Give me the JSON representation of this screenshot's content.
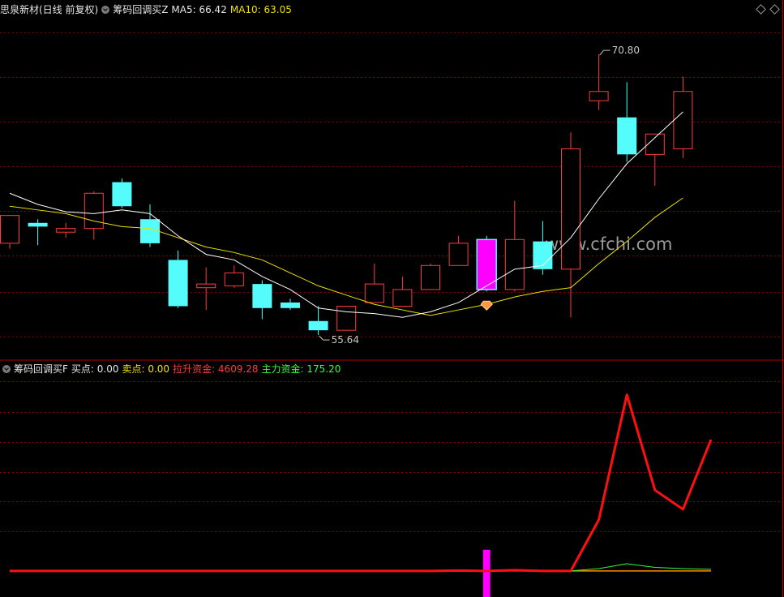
{
  "header_main": {
    "stock": "思泉新材(日线 前复权)",
    "indicator": "筹码回调买Z",
    "ma5_label": "MA5: 66.42",
    "ma10_label": "MA10: 63.05"
  },
  "header_sub": {
    "indicator": "筹码回调买F",
    "buy_label": "买点: 0.00",
    "sell_label": "卖点: 0.00",
    "lift_label": "拉升资金: 4609.28",
    "main_label": "主力资金: 175.20"
  },
  "watermark": "www.cfchi.com",
  "colors": {
    "up": "#ff3b3b",
    "down": "#54fcfc",
    "signal": "#ff00ff",
    "ma5": "#ffffff",
    "ma10": "#f0e000",
    "lift": "#ff1010",
    "main": "#33ff33",
    "grid": "#8b0000",
    "baseline": "#ff8800"
  },
  "chart_data": [
    {
      "type": "candlestick",
      "ylim": [
        54.9,
        72.6
      ],
      "high_annotation": "70.80",
      "low_annotation": "55.64",
      "candles": [
        {
          "o": 60.6,
          "h": 61.3,
          "c": 62.1,
          "l": 60.3
        },
        {
          "o": 61.7,
          "h": 61.9,
          "c": 61.5,
          "l": 60.5
        },
        {
          "o": 61.2,
          "h": 61.7,
          "c": 61.4,
          "l": 60.9
        },
        {
          "o": 61.4,
          "h": 63.4,
          "c": 63.3,
          "l": 60.8
        },
        {
          "o": 63.9,
          "h": 64.1,
          "c": 62.6,
          "l": 62.5
        },
        {
          "o": 61.9,
          "h": 62.7,
          "c": 60.6,
          "l": 60.4
        },
        {
          "o": 59.7,
          "h": 60.2,
          "c": 57.2,
          "l": 57.1
        },
        {
          "o": 58.2,
          "h": 59.3,
          "c": 58.4,
          "l": 57.0
        },
        {
          "o": 58.3,
          "h": 59.4,
          "c": 59.0,
          "l": 58.2
        },
        {
          "o": 58.4,
          "h": 58.6,
          "c": 57.1,
          "l": 56.5
        },
        {
          "o": 57.4,
          "h": 57.6,
          "c": 57.1,
          "l": 57.0
        },
        {
          "o": 56.4,
          "h": 57.2,
          "c": 55.9,
          "l": 55.64
        },
        {
          "o": 55.9,
          "h": 57.2,
          "c": 57.2,
          "l": 55.9
        },
        {
          "o": 57.4,
          "h": 59.5,
          "c": 58.4,
          "l": 57.4
        },
        {
          "o": 57.2,
          "h": 58.8,
          "c": 58.1,
          "l": 57.2
        },
        {
          "o": 58.1,
          "h": 59.5,
          "c": 59.4,
          "l": 58.1
        },
        {
          "o": 59.4,
          "h": 61.0,
          "c": 60.6,
          "l": 59.4
        },
        {
          "o": 60.8,
          "h": 61.0,
          "c": 58.1,
          "l": 58.0
        },
        {
          "o": 58.1,
          "h": 62.9,
          "c": 60.8,
          "l": 58.0
        },
        {
          "o": 60.7,
          "h": 61.8,
          "c": 59.2,
          "l": 58.9
        },
        {
          "o": 59.2,
          "h": 66.6,
          "c": 65.7,
          "l": 56.6
        },
        {
          "o": 68.3,
          "h": 70.8,
          "c": 68.8,
          "l": 67.8
        },
        {
          "o": 67.4,
          "h": 69.3,
          "c": 65.4,
          "l": 65.0
        },
        {
          "o": 65.4,
          "h": 65.9,
          "c": 66.5,
          "l": 63.7
        },
        {
          "o": 65.7,
          "h": 69.6,
          "c": 68.8,
          "l": 65.2
        }
      ],
      "ma5": [
        63.3,
        62.7,
        62.3,
        62.2,
        62.4,
        62.2,
        61.0,
        60.0,
        59.7,
        58.8,
        58.1,
        57.1,
        56.9,
        56.8,
        56.6,
        56.9,
        57.4,
        58.3,
        59.2,
        59.4,
        60.9,
        63.0,
        64.9,
        66.3,
        67.7
      ],
      "ma10": [
        62.6,
        62.4,
        62.2,
        61.8,
        61.5,
        61.4,
        60.9,
        60.4,
        60.1,
        59.7,
        59.0,
        58.3,
        57.8,
        57.3,
        57.0,
        56.7,
        57.0,
        57.3,
        57.7,
        58.0,
        58.2,
        59.5,
        60.7,
        62.0,
        63.05
      ],
      "signal_index": 17
    },
    {
      "type": "line",
      "ylim": [
        -650,
        4900
      ],
      "series": [
        {
          "name": "拉升资金",
          "values": [
            0,
            0,
            0,
            0,
            0,
            0,
            0,
            0,
            0,
            0,
            0,
            0,
            0,
            0,
            0,
            0,
            10,
            0,
            20,
            0,
            0,
            1280,
            4400,
            2020,
            1540,
            3280
          ]
        },
        {
          "name": "主力资金",
          "values": [
            0,
            0,
            0,
            0,
            0,
            0,
            0,
            0,
            0,
            0,
            0,
            0,
            0,
            0,
            0,
            0,
            0,
            0,
            0,
            0,
            0,
            60,
            180,
            90,
            60,
            40
          ]
        }
      ],
      "signal_bar_index": 17,
      "signal_bar_range": [
        -650,
        530
      ]
    }
  ]
}
